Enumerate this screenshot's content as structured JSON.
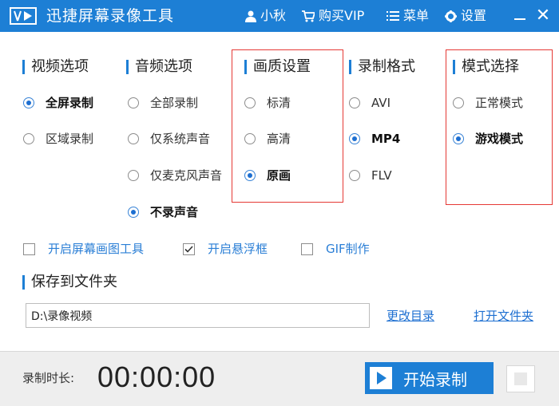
{
  "app": {
    "title": "迅捷屏幕录像工具"
  },
  "titlebar": {
    "user": "小秋",
    "vip": "购买VIP",
    "menu": "菜单",
    "settings": "设置",
    "minimize_icon": "minimize-icon",
    "close_glyph": "✕"
  },
  "video": {
    "title": "视频选项",
    "options": [
      {
        "label": "全屏录制",
        "selected": true
      },
      {
        "label": "区域录制",
        "selected": false
      }
    ]
  },
  "audio": {
    "title": "音频选项",
    "options": [
      {
        "label": "全部录制",
        "selected": false
      },
      {
        "label": "仅系统声音",
        "selected": false
      },
      {
        "label": "仅麦克风声音",
        "selected": false
      },
      {
        "label": "不录声音",
        "selected": true
      }
    ]
  },
  "quality": {
    "title": "画质设置",
    "options": [
      {
        "label": "标清",
        "selected": false
      },
      {
        "label": "高清",
        "selected": false
      },
      {
        "label": "原画",
        "selected": true
      }
    ]
  },
  "format": {
    "title": "录制格式",
    "options": [
      {
        "label": "AVI",
        "selected": false
      },
      {
        "label": "MP4",
        "selected": true
      },
      {
        "label": "FLV",
        "selected": false
      }
    ]
  },
  "mode": {
    "title": "模式选择",
    "options": [
      {
        "label": "正常模式",
        "selected": false
      },
      {
        "label": "游戏模式",
        "selected": true
      }
    ]
  },
  "checkboxes": [
    {
      "label": "开启屏幕画图工具",
      "checked": false
    },
    {
      "label": "开启悬浮框",
      "checked": true
    },
    {
      "label": "GIF制作",
      "checked": false
    }
  ],
  "save": {
    "title": "保存到文件夹",
    "path": "D:\\录像视频",
    "change_dir": "更改目录",
    "open_folder": "打开文件夹"
  },
  "footer": {
    "duration_label": "录制时长:",
    "duration_value": "00:00:00",
    "start_label": "开始录制"
  },
  "colors": {
    "accent": "#1d7fd5",
    "highlight_box": "#e53935",
    "link": "#1d6fd1"
  }
}
